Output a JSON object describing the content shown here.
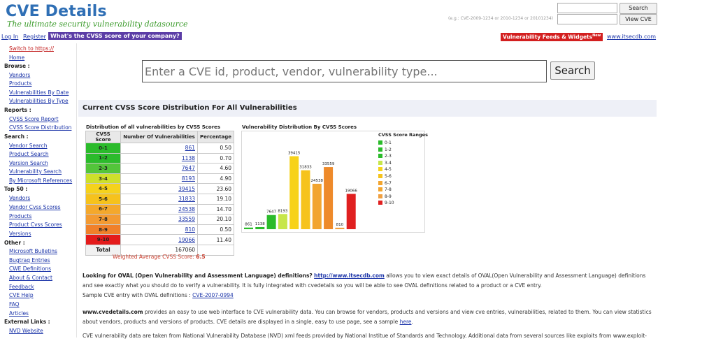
{
  "header": {
    "logo_title": "CVE Details",
    "logo_tagline": "The ultimate security vulnerability datasource",
    "search_hint": "(e.g.: CVE-2009-1234 or 2010-1234 or 20101234)",
    "search_button": "Search",
    "view_cve_button": "View CVE",
    "login": "Log In",
    "register": "Register",
    "cvss_company": "What's the CVSS score of your company?",
    "feeds_label": "Vulnerability Feeds & Widgets",
    "feeds_badge": "New",
    "itsecdb_link": "www.itsecdb.com"
  },
  "sidebar": {
    "switch_https": "Switch to https://",
    "home": "Home",
    "browse_head": "Browse :",
    "browse": [
      "Vendors",
      "Products",
      "Vulnerabilities By Date",
      "Vulnerabilities By Type"
    ],
    "reports_head": "Reports :",
    "reports": [
      "CVSS Score Report",
      "CVSS Score Distribution"
    ],
    "search_head": "Search :",
    "search": [
      "Vendor Search",
      "Product Search",
      "Version Search",
      "Vulnerability Search",
      "By Microsoft References"
    ],
    "top50_head": "Top 50 :",
    "top50": [
      "Vendors",
      "Vendor Cvss Scores",
      "Products",
      "Product Cvss Scores",
      "Versions"
    ],
    "other_head": "Other :",
    "other": [
      "Microsoft Bulletins",
      "Bugtraq Entries",
      "CWE Definitions",
      "About & Contact",
      "Feedback",
      "CVE Help",
      "FAQ",
      "Articles"
    ],
    "external_head": "External Links :",
    "external": [
      "NVD Website"
    ]
  },
  "main_search": {
    "placeholder": "Enter a CVE id, product, vendor, vulnerability type...",
    "button": "Search"
  },
  "section_title": "Current CVSS Score Distribution For All Vulnerabilities",
  "distribution": {
    "title": "Distribution of all vulnerabilities by CVSS Scores",
    "headers": [
      "CVSS Score",
      "Number Of Vulnerabilities",
      "Percentage"
    ],
    "rows": [
      {
        "score": "0-1",
        "count": "861",
        "pct": "0.50",
        "color": "#2bbb2b"
      },
      {
        "score": "1-2",
        "count": "1138",
        "pct": "0.70",
        "color": "#2bbb2b"
      },
      {
        "score": "2-3",
        "count": "7647",
        "pct": "4.60",
        "color": "#53c53a"
      },
      {
        "score": "3-4",
        "count": "8193",
        "pct": "4.90",
        "color": "#cde02b"
      },
      {
        "score": "4-5",
        "count": "39415",
        "pct": "23.60",
        "color": "#f5d21c"
      },
      {
        "score": "5-6",
        "count": "31833",
        "pct": "19.10",
        "color": "#f6c21c"
      },
      {
        "score": "6-7",
        "count": "24538",
        "pct": "14.70",
        "color": "#f4a82c"
      },
      {
        "score": "7-8",
        "count": "33559",
        "pct": "20.10",
        "color": "#f39a32"
      },
      {
        "score": "8-9",
        "count": "810",
        "pct": "0.50",
        "color": "#f0802a"
      },
      {
        "score": "9-10",
        "count": "19066",
        "pct": "11.40",
        "color": "#e41b1b"
      }
    ],
    "total_label": "Total",
    "total_value": "167060",
    "weighted_label": "Weighted Average CVSS Score:",
    "weighted_value": "6.5"
  },
  "chart_data": {
    "type": "bar",
    "title": "Vulnerability Distribution By CVSS Scores",
    "categories": [
      "0-1",
      "1-2",
      "2-3",
      "3-4",
      "4-5",
      "5-6",
      "6-7",
      "7-8",
      "8-9",
      "9-10"
    ],
    "values": [
      861,
      1138,
      7647,
      8193,
      39415,
      31833,
      24538,
      33559,
      810,
      19066
    ],
    "colors": [
      "#2bbb2b",
      "#2bbb2b",
      "#2bbb2b",
      "#c7e64a",
      "#f7d219",
      "#f6c31c",
      "#f2a52f",
      "#ee8a2a",
      "#f0a040",
      "#e02020"
    ],
    "legend_title": "CVSS Score Ranges",
    "legend": [
      "0-1",
      "1-2",
      "2-3",
      "3-4",
      "4-5",
      "5-6",
      "6-7",
      "7-8",
      "8-9",
      "9-10"
    ],
    "legend_colors": [
      "#2bbb2b",
      "#2bbb2b",
      "#2bbb2b",
      "#c7e64a",
      "#f7d219",
      "#f6c31c",
      "#f2a52f",
      "#f2a52f",
      "#f0a040",
      "#e02020"
    ],
    "ylim": [
      0,
      40000
    ],
    "grid": false,
    "legend_position": "right"
  },
  "content": {
    "p1_bold": "Looking for OVAL (Open Vulnerability and Assessment Language) definitions?",
    "p1_link": "http://www.itsecdb.com",
    "p1_rest": "allows you to view exact details of OVAL(Open Vulnerability and Assessment Language) definitions",
    "p1_line2": "and see exactly what you should do to verify a vulnerability. It is fully integrated with cvedetails so you will be able to see OVAL definitions related to a product or a CVE entry.",
    "p1_line3": "Sample CVE entry with OVAL definitions :",
    "p1_sample_link": "CVE-2007-0994",
    "p2_bold": "www.cvedetails.com",
    "p2_rest": "provides an easy to use web interface to CVE vulnerability data. You can browse for vendors, products and versions and view cve entries, vulnerabilities, related to them. You can view statistics",
    "p2_line2": "about vendors, products and versions of products. CVE details are displayed in a single, easy to use page, see a sample",
    "p2_here": "here",
    "p3": "CVE vulnerability data are taken from National Vulnerability Database (NVD) xml feeds provided by National Institue of Standards and Technology. Additional data from several sources like exploits from www.exploit-"
  }
}
